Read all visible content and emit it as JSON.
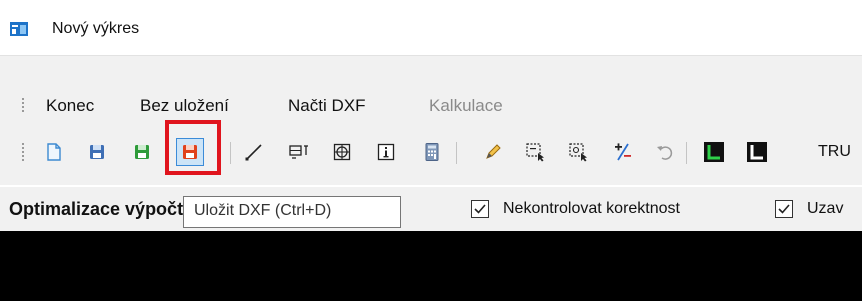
{
  "window": {
    "title": "Nový výkres",
    "icon": "app-icon"
  },
  "menu": {
    "items": [
      {
        "label": "Konec",
        "enabled": true
      },
      {
        "label": "Bez uložení",
        "enabled": true
      },
      {
        "label": "Načti DXF",
        "enabled": true
      },
      {
        "label": "Kalkulace",
        "enabled": false
      }
    ]
  },
  "toolbar": {
    "buttons": [
      {
        "icon": "new-document-icon"
      },
      {
        "icon": "save-blue-icon"
      },
      {
        "icon": "save-green-icon"
      },
      {
        "icon": "save-dxf-icon",
        "active": true
      },
      {
        "icon": "line-icon"
      },
      {
        "icon": "text-grid-icon"
      },
      {
        "icon": "target-icon"
      },
      {
        "icon": "info-icon"
      },
      {
        "icon": "calculator-icon"
      },
      {
        "icon": "pencil-icon"
      },
      {
        "icon": "select-box-icon"
      },
      {
        "icon": "select-box-alt-icon"
      },
      {
        "icon": "plus-minus-icon"
      },
      {
        "icon": "undo-icon"
      },
      {
        "icon": "corner-green-icon"
      },
      {
        "icon": "corner-black-icon"
      }
    ],
    "trailing_text": "TRU"
  },
  "options": {
    "title": "Optimalizace výpočtu technologie",
    "checkboxes": [
      {
        "label": "Nekontrolovat korektnost",
        "checked": true
      },
      {
        "label": "Uzav",
        "checked": true
      }
    ]
  },
  "tooltip": {
    "text": "Uložit DXF (Ctrl+D)"
  },
  "colors": {
    "highlight": "#e0141d",
    "canvas": "#000000",
    "menubar": "#f1f1f1"
  }
}
